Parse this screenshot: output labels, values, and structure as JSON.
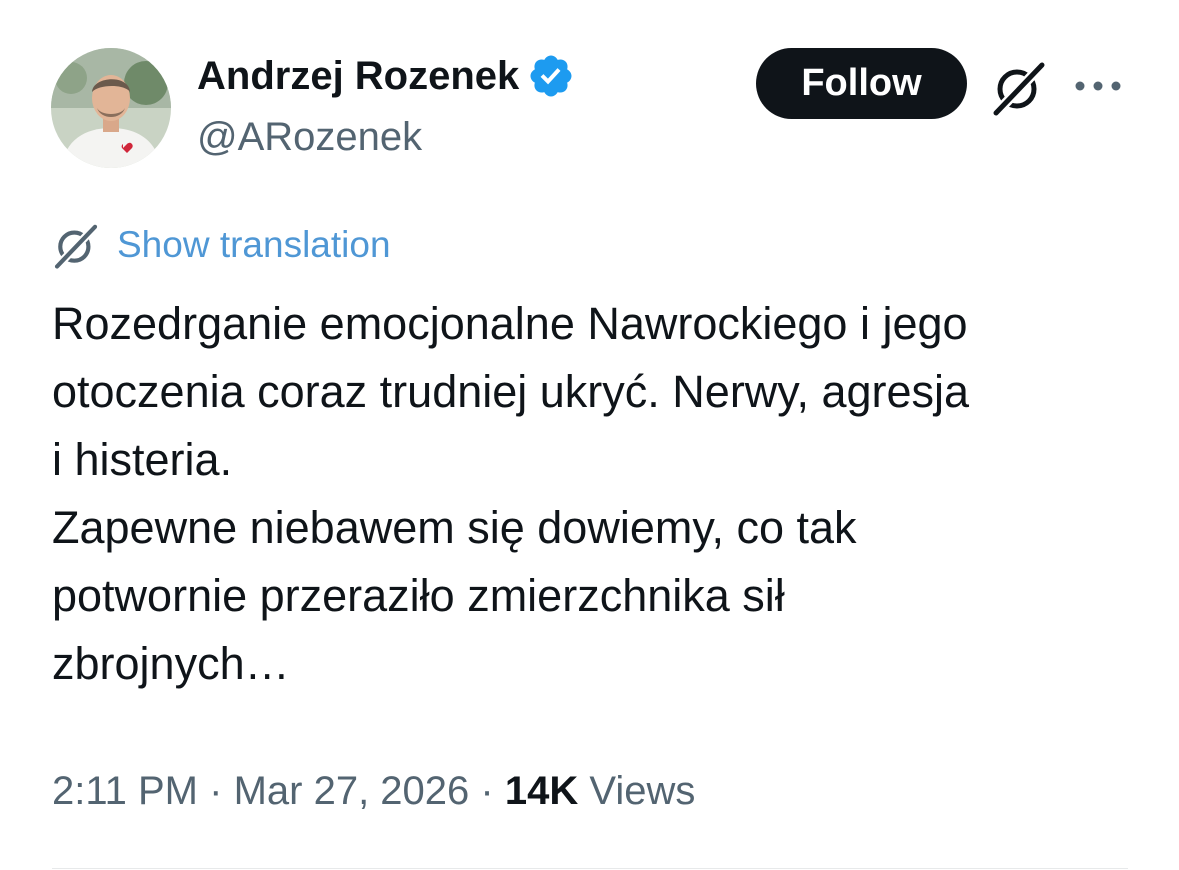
{
  "author": {
    "display_name": "Andrzej Rozenek",
    "handle": "@ARozenek",
    "verified": true,
    "avatar_icon": "profile-photo"
  },
  "header": {
    "follow_label": "Follow",
    "grok_icon": "grok-icon",
    "more_icon": "more-icon"
  },
  "translation": {
    "label": "Show translation",
    "icon": "grok-icon"
  },
  "tweet": {
    "lines": [
      "Rozedrganie emocjonalne Nawrockiego i jego",
      "otoczenia coraz trudniej ukryć. Nerwy, agresja",
      "i histeria.",
      "Zapewne niebawem się dowiemy, co tak",
      "potwornie przeraziło zmierzchnika sił",
      "zbrojnych…"
    ]
  },
  "meta": {
    "time": "2:11 PM",
    "date": "Mar 27, 2026",
    "separator": "·",
    "views_count": "14K",
    "views_label": "Views"
  },
  "colors": {
    "text": "#0f1419",
    "secondary": "#536471",
    "link": "#4f97d5",
    "verified": "#1d9bf0",
    "button": "#0f1419"
  }
}
